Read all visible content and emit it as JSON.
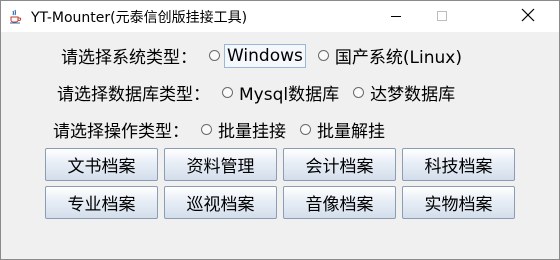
{
  "window": {
    "title": "YT-Mounter(元泰信创版挂接工具)"
  },
  "system_row": {
    "label": "请选择系统类型：",
    "options": [
      "Windows",
      "国产系统(Linux)"
    ]
  },
  "db_row": {
    "label": "请选择数据库类型：",
    "options": [
      "Mysql数据库",
      "达梦数据库"
    ]
  },
  "op_row": {
    "label": "请选择操作类型：",
    "options": [
      "批量挂接",
      "批量解挂"
    ]
  },
  "archive_buttons": [
    "文书档案",
    "资料管理",
    "会计档案",
    "科技档案",
    "专业档案",
    "巡视档案",
    "音像档案",
    "实物档案"
  ],
  "icons": {
    "app": "java-cup-icon",
    "minimize": "minimize-icon",
    "maximize": "maximize-icon",
    "close": "close-icon"
  },
  "colors": {
    "window_bg": "#f0f0f0",
    "titlebar_bg": "#ffffff",
    "button_border": "#8a9db5",
    "focus_border": "#9ab8d6"
  }
}
